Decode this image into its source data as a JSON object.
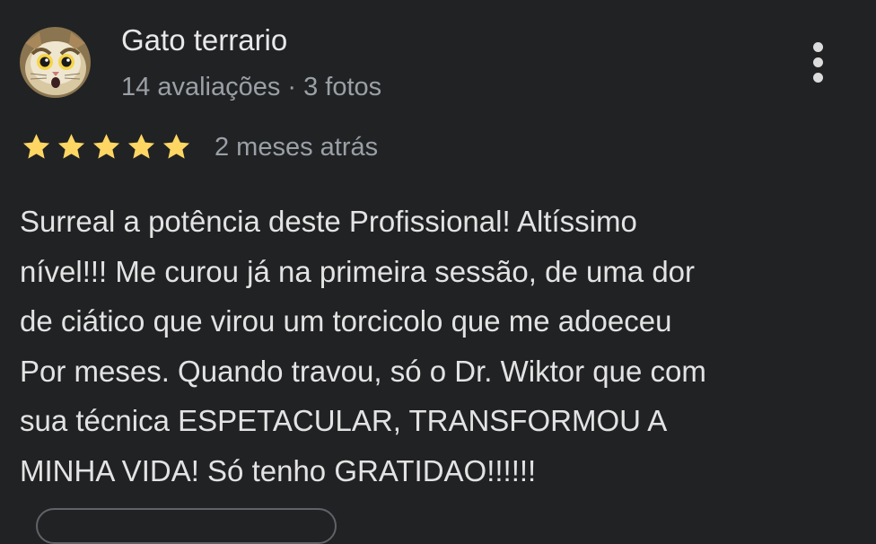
{
  "review": {
    "author": {
      "name": "Gato terrario",
      "meta": "14 avaliações · 3 fotos",
      "avatar_icon": "cat-avatar"
    },
    "menu_icon": "more-vert-icon",
    "rating": {
      "stars": 5,
      "max": 5,
      "star_color": "#fdd663"
    },
    "date": "2 meses atrás",
    "text_lines": [
      "Surreal a potência deste Profissional! Altíssimo",
      "nível!!! Me curou já na primeira sessão, de uma dor",
      "de ciático que virou um torcicolo que me adoeceu",
      "Por meses. Quando travou, só o Dr. Wiktor que com",
      "sua técnica ESPETACULAR, TRANSFORMOU A",
      "MINHA VIDA! Só tenho GRATIDAO!!!!!!"
    ]
  },
  "colors": {
    "background": "#212224",
    "primary_text": "#e3e3e3",
    "secondary_text": "#9aa0a6"
  }
}
